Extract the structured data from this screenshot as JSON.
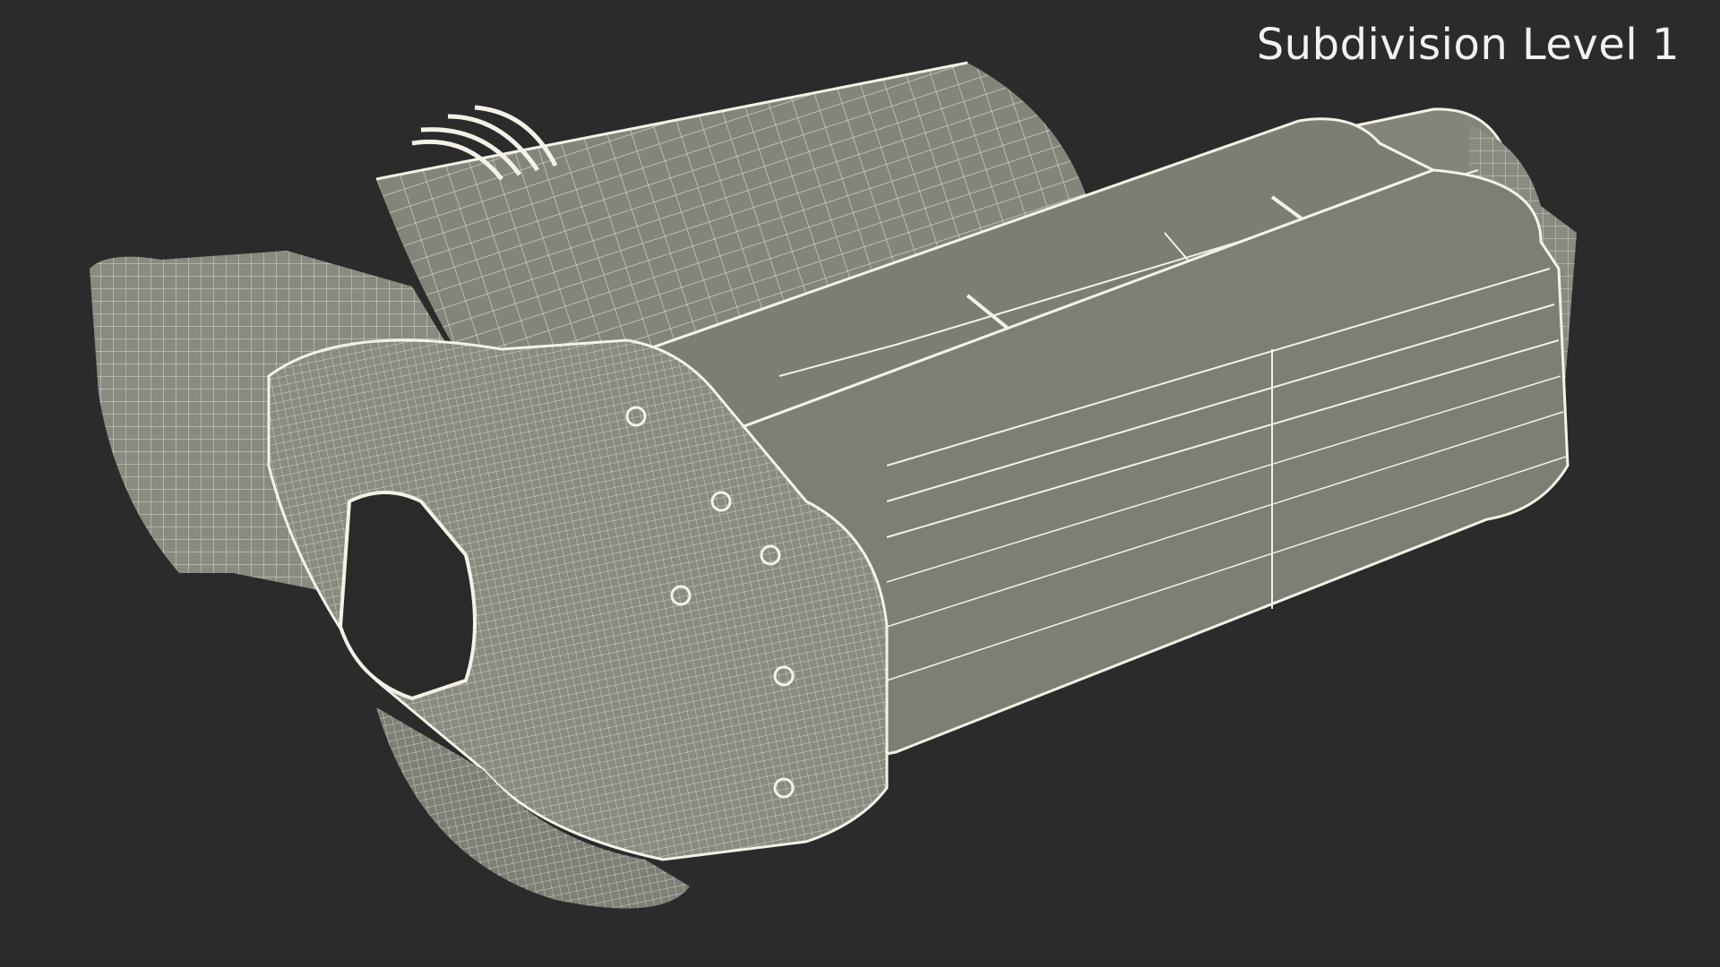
{
  "viewport": {
    "background": "#2b2b2b",
    "overlay_label": "Subdivision Level 1"
  },
  "model": {
    "shading": "wireframe-over-solid",
    "surface_color": "#84847a",
    "wire_color": "#f4f2e6",
    "shadow_color": "#1e1e1e"
  }
}
